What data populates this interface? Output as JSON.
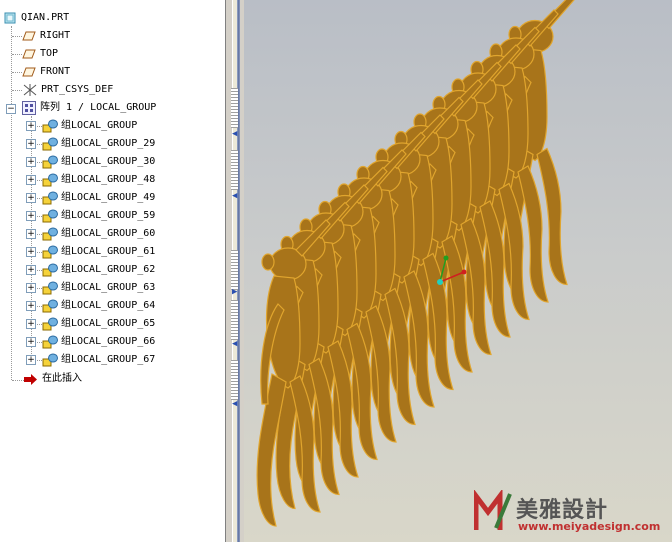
{
  "tree": {
    "root": "QIAN.PRT",
    "datums": [
      {
        "label": "RIGHT",
        "icon": "datum-plane-icon"
      },
      {
        "label": "TOP",
        "icon": "datum-plane-icon"
      },
      {
        "label": "FRONT",
        "icon": "datum-plane-icon"
      }
    ],
    "csys": "PRT_CSYS_DEF",
    "pattern": "阵列 1 / LOCAL_GROUP",
    "groups": [
      "组LOCAL_GROUP",
      "组LOCAL_GROUP_29",
      "组LOCAL_GROUP_30",
      "组LOCAL_GROUP_48",
      "组LOCAL_GROUP_49",
      "组LOCAL_GROUP_59",
      "组LOCAL_GROUP_60",
      "组LOCAL_GROUP_61",
      "组LOCAL_GROUP_62",
      "组LOCAL_GROUP_63",
      "组LOCAL_GROUP_64",
      "组LOCAL_GROUP_65",
      "组LOCAL_GROUP_66",
      "组LOCAL_GROUP_67"
    ],
    "insert_here": "在此插入"
  },
  "watermark": {
    "brand": "美雅設計",
    "url": "www.meiyadesign.com"
  },
  "colors": {
    "model_fill": "#a8741a",
    "model_edge": "#e0a52e",
    "insert_arrow": "#c00000"
  }
}
